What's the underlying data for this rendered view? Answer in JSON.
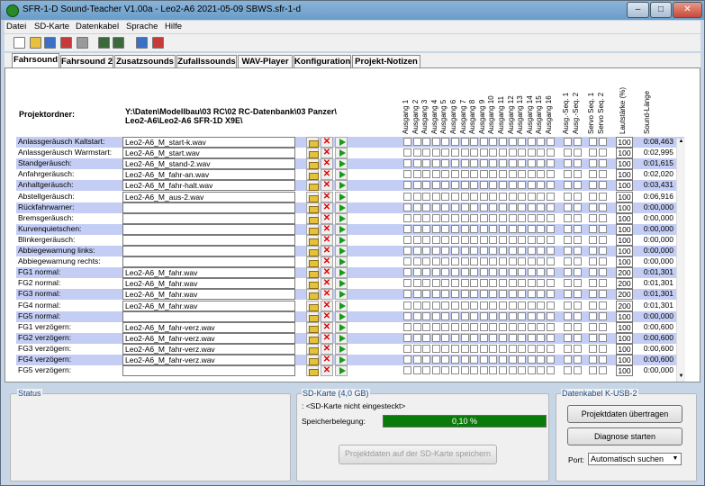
{
  "window": {
    "title": "SFR-1-D Sound-Teacher V1.00a - Leo2-A6 2021-05-09 SBWS.sfr-1-d"
  },
  "menu": [
    "Datei",
    "SD-Karte",
    "Datenkabel",
    "Sprache",
    "Hilfe"
  ],
  "toolbar": [
    "new-icon",
    "open-icon",
    "save-icon",
    "save-as-icon",
    "print-icon",
    "export-icon",
    "import-icon",
    "music-icon",
    "document-icon"
  ],
  "tabs": [
    "Fahrsound",
    "Fahrsound 2",
    "Zusatzsounds",
    "Zufallssounds",
    "WAV-Player",
    "Konfiguration",
    "Projekt-Notizen"
  ],
  "active_tab": "Fahrsound",
  "project": {
    "label": "Projektordner:",
    "path1": "Y:\\Daten\\Modellbau\\03 RC\\02 RC-Datenbank\\03 Panzer\\",
    "path2": "Leo2-A6\\Leo2-A6 SFR-1D X9E\\"
  },
  "columns": [
    "Ausgang 1",
    "Ausgang 2",
    "Ausgang 3",
    "Ausgang 4",
    "Ausgang 5",
    "Ausgang 6",
    "Ausgang 7",
    "Ausgang 8",
    "Ausgang 9",
    "Ausgang 10",
    "Ausgang 11",
    "Ausgang 12",
    "Ausgang 13",
    "Ausgang 14",
    "Ausgang 15",
    "Ausgang 16",
    "Ausg.-Seq. 1",
    "Ausg.-Seq. 2",
    "Servo Seq. 1",
    "Servo Seq. 2",
    "Lautstärke (%)",
    "Sound-Länge"
  ],
  "rows": [
    {
      "label": "Anlassgeräusch Kaltstart:",
      "file": "Leo2-A6_M_start-k.wav",
      "volume": "100",
      "length": "0:08,463"
    },
    {
      "label": "Anlassgeräusch Warmstart:",
      "file": "Leo2-A6_M_start.wav",
      "volume": "100",
      "length": "0:02,995"
    },
    {
      "label": "Standgeräusch:",
      "file": "Leo2-A6_M_stand-2.wav",
      "volume": "100",
      "length": "0:01,615"
    },
    {
      "label": "Anfahrgeräusch:",
      "file": "Leo2-A6_M_fahr-an.wav",
      "volume": "100",
      "length": "0:02,020"
    },
    {
      "label": "Anhaltgeräusch:",
      "file": "Leo2-A6_M_fahr-halt.wav",
      "volume": "100",
      "length": "0:03,431"
    },
    {
      "label": "Abstellgeräusch:",
      "file": "Leo2-A6_M_aus-2.wav",
      "volume": "100",
      "length": "0:06,916"
    },
    {
      "label": "Rückfahrwarner:",
      "file": "",
      "volume": "100",
      "length": "0:00,000"
    },
    {
      "label": "Bremsgeräusch:",
      "file": "",
      "volume": "100",
      "length": "0:00,000"
    },
    {
      "label": "Kurvenquietschen:",
      "file": "",
      "volume": "100",
      "length": "0:00,000"
    },
    {
      "label": "Blinkergeräusch:",
      "file": "",
      "volume": "100",
      "length": "0:00,000"
    },
    {
      "label": "Abbiegewarnung links:",
      "file": "",
      "volume": "100",
      "length": "0:00,000"
    },
    {
      "label": "Abbiegewarnung rechts:",
      "file": "",
      "volume": "100",
      "length": "0:00,000"
    },
    {
      "label": "FG1 normal:",
      "file": "Leo2-A6_M_fahr.wav",
      "volume": "200",
      "length": "0:01,301"
    },
    {
      "label": "FG2 normal:",
      "file": "Leo2-A6_M_fahr.wav",
      "volume": "200",
      "length": "0:01,301"
    },
    {
      "label": "FG3 normal:",
      "file": "Leo2-A6_M_fahr.wav",
      "volume": "200",
      "length": "0:01,301"
    },
    {
      "label": "FG4 normal:",
      "file": "Leo2-A6_M_fahr.wav",
      "volume": "200",
      "length": "0:01,301"
    },
    {
      "label": "FG5 normal:",
      "file": "",
      "volume": "100",
      "length": "0:00,000"
    },
    {
      "label": "FG1 verzögern:",
      "file": "Leo2-A6_M_fahr-verz.wav",
      "volume": "100",
      "length": "0:00,600"
    },
    {
      "label": "FG2 verzögern:",
      "file": "Leo2-A6_M_fahr-verz.wav",
      "volume": "100",
      "length": "0:00,600"
    },
    {
      "label": "FG3 verzögern:",
      "file": "Leo2-A6_M_fahr-verz.wav",
      "volume": "100",
      "length": "0:00,600"
    },
    {
      "label": "FG4 verzögern:",
      "file": "Leo2-A6_M_fahr-verz.wav",
      "volume": "100",
      "length": "0:00,600"
    },
    {
      "label": "FG5 verzögern:",
      "file": "",
      "volume": "100",
      "length": "0:00,000"
    }
  ],
  "status": {
    "title": "Status"
  },
  "sd": {
    "title": "SD-Karte (4,0 GB)",
    "state": ": <SD-Karte nicht eingesteckt>",
    "mem_label": "Speicherbelegung:",
    "mem_value": "0,10 %",
    "mem_fraction": 0.001,
    "save_button": "Projektdaten auf der SD-Karte speichern"
  },
  "cable": {
    "title": "Datenkabel K-USB-2",
    "transfer_button": "Projektdaten übertragen",
    "diag_button": "Diagnose starten",
    "port_label": "Port:",
    "port_value": "Automatisch suchen"
  }
}
